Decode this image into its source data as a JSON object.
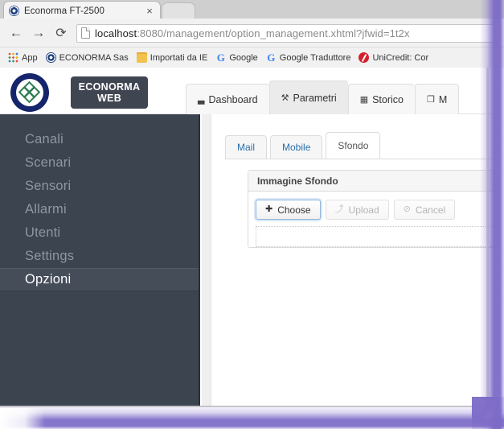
{
  "browser": {
    "tab": {
      "title": "Econorma FT-2500",
      "favicon": "econorma-logo-icon",
      "close": "×"
    },
    "nav": {
      "back": "←",
      "forward": "→",
      "reload": "⟳"
    },
    "omnibox": {
      "page_icon": "page-document-icon",
      "url_host": "localhost",
      "url_rest": ":8080/management/option_management.xhtml?jfwid=1t2x"
    },
    "bookmarks": [
      {
        "label": "App",
        "icon": "apps-grid-icon"
      },
      {
        "label": "ECONORMA  Sas",
        "icon": "econorma-logo-icon"
      },
      {
        "label": "Importati da IE",
        "icon": "folder-icon"
      },
      {
        "label": "Google",
        "icon": "google-g-icon"
      },
      {
        "label": "Google Traduttore",
        "icon": "google-g-icon"
      },
      {
        "label": "UniCredit: Cor",
        "icon": "unicredit-icon"
      }
    ]
  },
  "app": {
    "brand": {
      "line1": "ECONORMA",
      "line2": "WEB",
      "logo": "econorma-logo-icon"
    },
    "topnav": [
      {
        "label": "Dashboard",
        "icon": "▃",
        "active": false
      },
      {
        "label": "Parametri",
        "icon": "⚒",
        "active": true
      },
      {
        "label": "Storico",
        "icon": "▦",
        "active": false
      },
      {
        "label": "M",
        "icon": "❐",
        "active": false
      }
    ],
    "sidebar": {
      "items": [
        {
          "label": "Canali",
          "active": false
        },
        {
          "label": "Scenari",
          "active": false
        },
        {
          "label": "Sensori",
          "active": false
        },
        {
          "label": "Allarmi",
          "active": false
        },
        {
          "label": "Utenti",
          "active": false
        },
        {
          "label": "Settings",
          "active": false
        },
        {
          "label": "Opzioni",
          "active": true
        }
      ]
    },
    "subtabs": [
      {
        "label": "Mail",
        "active": false
      },
      {
        "label": "Mobile",
        "active": false
      },
      {
        "label": "Sfondo",
        "active": true
      }
    ],
    "panel": {
      "title": "Immagine Sfondo",
      "buttons": [
        {
          "label": "Choose",
          "icon": "✚",
          "icon_name": "plus-icon",
          "state": "focused"
        },
        {
          "label": "Upload",
          "icon": "⤴",
          "icon_name": "upload-arrow-icon",
          "state": "disabled"
        },
        {
          "label": "Cancel",
          "icon": "⊘",
          "icon_name": "ban-circle-icon",
          "state": "disabled"
        }
      ]
    }
  },
  "colors": {
    "sidebar_bg": "#3c4450",
    "sidebar_active_bg": "#454d59",
    "brand_btn_bg": "#3f4651",
    "logo_navy": "#15256b",
    "logo_green": "#2e7d52",
    "link_blue": "#2b6ea8",
    "highlight_purple": "#7c6ac7"
  }
}
